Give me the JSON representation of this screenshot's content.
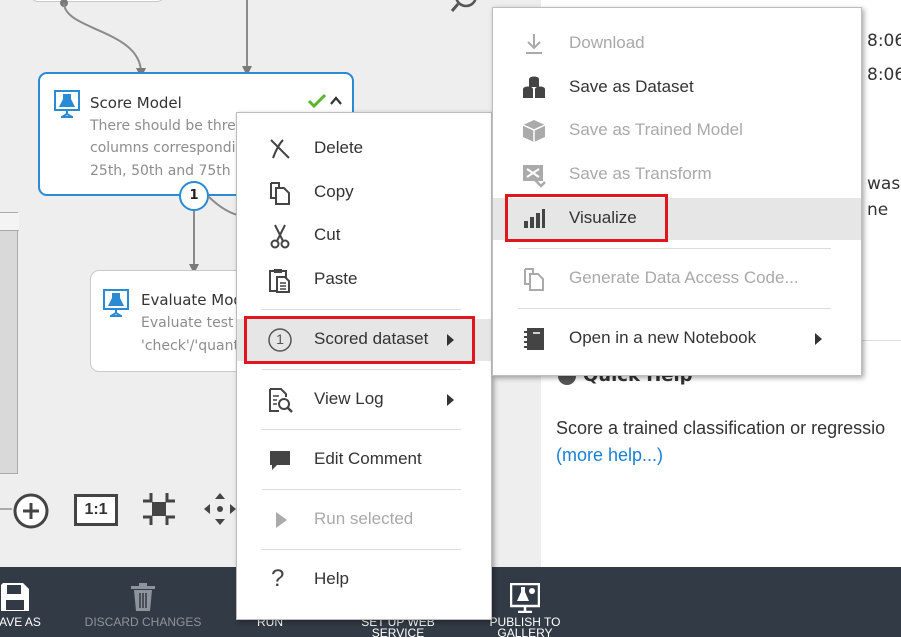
{
  "canvas": {
    "score_node": {
      "title": "Score Model",
      "desc_line1": "There should be three",
      "desc_line2": "columns correspondi",
      "desc_line3": "25th, 50th and 75th p",
      "port_label": "1"
    },
    "evaluate_node": {
      "title": "Evaluate Mod",
      "desc_line1": "Evaluate test s",
      "desc_line2": "'check'/'quant"
    },
    "zoom_actual_label": "1:1"
  },
  "context_menu": {
    "delete": "Delete",
    "copy": "Copy",
    "cut": "Cut",
    "paste": "Paste",
    "scored_dataset": "Scored dataset",
    "scored_dataset_index": "1",
    "view_log": "View Log",
    "edit_comment": "Edit Comment",
    "run_selected": "Run selected",
    "help": "Help"
  },
  "submenu": {
    "download": "Download",
    "save_as_dataset": "Save as Dataset",
    "save_as_trained_model": "Save as Trained Model",
    "save_as_transform": "Save as Transform",
    "visualize": "Visualize",
    "generate_data_access_code": "Generate Data Access Code...",
    "open_notebook": "Open in a new Notebook"
  },
  "right_panel": {
    "time_1": "8:06",
    "time_2": "8:06",
    "was_fragment": "was",
    "ne_fragment": "ne",
    "quick_help_title": "Quick Help",
    "quick_help_text": "Score a trained classification or regressio",
    "more_help_link": "(more help...)"
  },
  "bottom_bar": {
    "save_as": "AVE AS",
    "discard_changes": "DISCARD CHANGES",
    "run": "RUN",
    "set_up_web_service_1": "SET UP WEB",
    "set_up_web_service_2": "SERVICE",
    "publish_to_gallery_1": "PUBLISH TO",
    "publish_to_gallery_2": "GALLERY"
  },
  "colors": {
    "accent_blue": "#2a8ad4",
    "highlight_red": "#e0161e",
    "check_green": "#5cb531",
    "bottom_bar": "#323a45",
    "link_blue": "#1a7fd4"
  }
}
